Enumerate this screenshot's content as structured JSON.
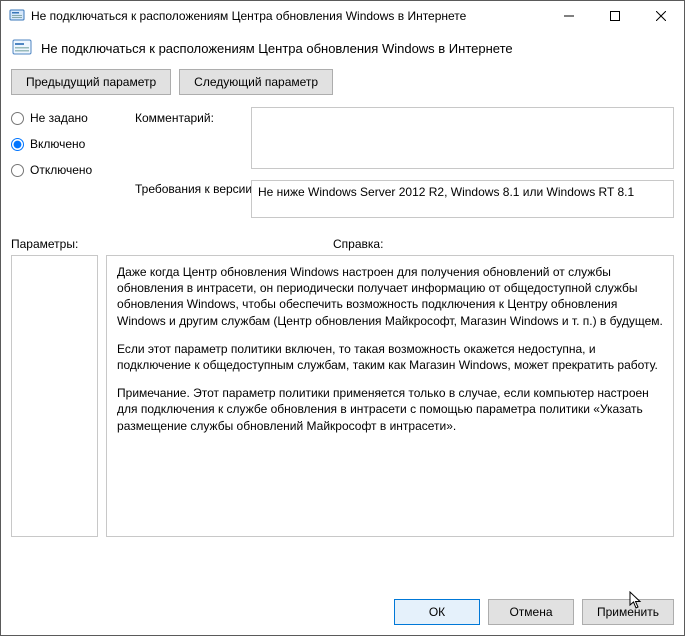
{
  "window": {
    "title": "Не подключаться к расположениям Центра обновления Windows в Интернете",
    "subtitle": "Не подключаться к расположениям Центра обновления Windows в Интернете"
  },
  "nav": {
    "prev": "Предыдущий параметр",
    "next": "Следующий параметр"
  },
  "radio": {
    "not_configured": "Не задано",
    "enabled": "Включено",
    "disabled": "Отключено",
    "selected": "enabled"
  },
  "labels": {
    "comment": "Комментарий:",
    "requirements": "Требования к версии:",
    "parameters": "Параметры:",
    "help": "Справка:"
  },
  "fields": {
    "comment": "",
    "requirements": "Не ниже Windows Server 2012 R2, Windows 8.1 или Windows RT 8.1"
  },
  "help": {
    "p1": "Даже когда Центр обновления Windows настроен для получения обновлений от службы обновления в интрасети, он периодически получает информацию от общедоступной службы обновления Windows, чтобы обеспечить возможность подключения к Центру обновления Windows и другим службам (Центр обновления Майкрософт, Магазин Windows и т. п.) в будущем.",
    "p2": "Если этот параметр политики включен, то такая возможность окажется недоступна, и подключение к общедоступным службам, таким как Магазин Windows, может прекратить работу.",
    "p3": "Примечание. Этот параметр политики применяется только в случае, если компьютер настроен для подключения к службе обновления в интрасети с помощью параметра политики «Указать размещение службы обновлений Майкрософт в интрасети»."
  },
  "footer": {
    "ok": "ОК",
    "cancel": "Отмена",
    "apply": "Применить"
  }
}
